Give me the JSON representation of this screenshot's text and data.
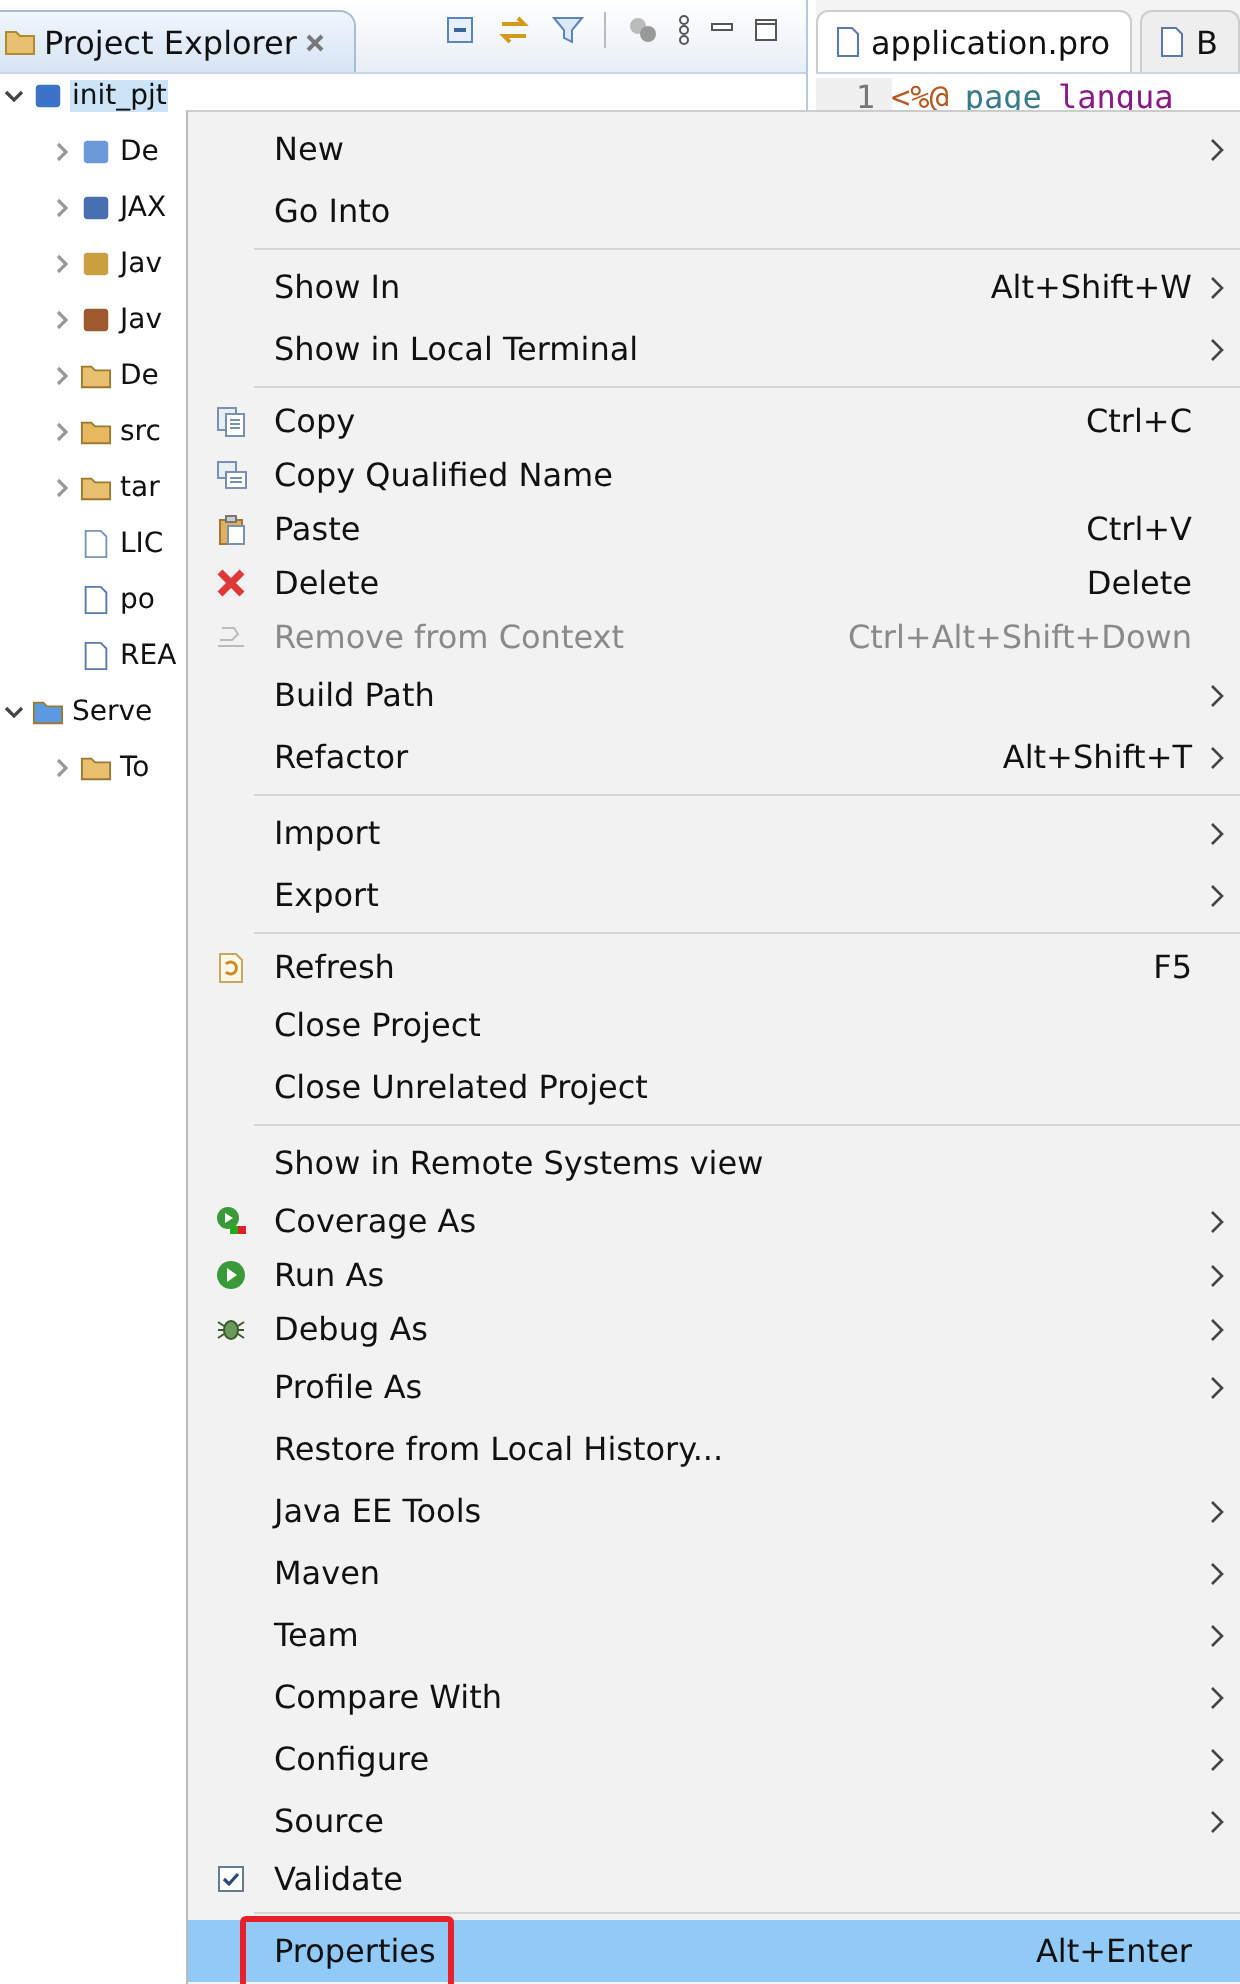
{
  "explorer": {
    "title": "Project Explorer",
    "tree": [
      {
        "label": "init_pjt",
        "kind": "node",
        "expanded": true,
        "selected": true,
        "children": [
          {
            "label": "De",
            "kind": "node",
            "expanded": false,
            "selected": false
          },
          {
            "label": "JAX",
            "kind": "node",
            "expanded": false,
            "selected": false
          },
          {
            "label": "Jav",
            "kind": "node",
            "expanded": false,
            "selected": false
          },
          {
            "label": "Jav",
            "kind": "node",
            "expanded": false,
            "selected": false
          },
          {
            "label": "De",
            "kind": "node",
            "expanded": false,
            "selected": false
          },
          {
            "label": "src",
            "kind": "node",
            "expanded": false,
            "selected": false
          },
          {
            "label": "tar",
            "kind": "node",
            "expanded": false,
            "selected": false
          },
          {
            "label": "LIC",
            "kind": "leaf",
            "selected": false
          },
          {
            "label": "po",
            "kind": "leaf",
            "selected": false
          },
          {
            "label": "REA",
            "kind": "leaf",
            "selected": false
          }
        ]
      },
      {
        "label": "Serve",
        "kind": "node",
        "expanded": true,
        "selected": false,
        "children": [
          {
            "label": "To",
            "kind": "node",
            "expanded": false,
            "selected": false
          }
        ]
      }
    ]
  },
  "editor": {
    "tabs": [
      {
        "label": "application.pro",
        "selected": true
      },
      {
        "label": "B",
        "selected": false
      }
    ],
    "lines": [
      {
        "number": "1",
        "tokens": [
          {
            "text": "<%@",
            "kind": "tag"
          },
          {
            "text": "page",
            "kind": "keyword"
          },
          {
            "text": "langua",
            "kind": "attr"
          }
        ]
      }
    ]
  },
  "menu": [
    {
      "kind": "item",
      "label": "New",
      "submenu": true,
      "disabled": false,
      "selected": false,
      "outlined": false
    },
    {
      "kind": "item",
      "label": "Go Into",
      "submenu": false,
      "disabled": false,
      "selected": false,
      "outlined": false
    },
    {
      "kind": "separator"
    },
    {
      "kind": "item",
      "label": "Show In",
      "shortcut": "Alt+Shift+W",
      "submenu": true,
      "disabled": false,
      "selected": false,
      "outlined": false
    },
    {
      "kind": "item",
      "label": "Show in Local Terminal",
      "submenu": true,
      "disabled": false,
      "selected": false,
      "outlined": false
    },
    {
      "kind": "separator"
    },
    {
      "kind": "item",
      "label": "Copy",
      "shortcut": "Ctrl+C",
      "submenu": false,
      "disabled": false,
      "selected": false,
      "outlined": false
    },
    {
      "kind": "item",
      "label": "Copy Qualified Name",
      "submenu": false,
      "disabled": false,
      "selected": false,
      "outlined": false
    },
    {
      "kind": "item",
      "label": "Paste",
      "shortcut": "Ctrl+V",
      "submenu": false,
      "disabled": false,
      "selected": false,
      "outlined": false
    },
    {
      "kind": "item",
      "label": "Delete",
      "shortcut": "Delete",
      "submenu": false,
      "disabled": false,
      "selected": false,
      "outlined": false
    },
    {
      "kind": "item",
      "label": "Remove from Context",
      "shortcut": "Ctrl+Alt+Shift+Down",
      "submenu": false,
      "disabled": true,
      "selected": false,
      "outlined": false
    },
    {
      "kind": "item",
      "label": "Build Path",
      "submenu": true,
      "disabled": false,
      "selected": false,
      "outlined": false
    },
    {
      "kind": "item",
      "label": "Refactor",
      "shortcut": "Alt+Shift+T",
      "submenu": true,
      "disabled": false,
      "selected": false,
      "outlined": false
    },
    {
      "kind": "separator"
    },
    {
      "kind": "item",
      "label": "Import",
      "submenu": true,
      "disabled": false,
      "selected": false,
      "outlined": false
    },
    {
      "kind": "item",
      "label": "Export",
      "submenu": true,
      "disabled": false,
      "selected": false,
      "outlined": false
    },
    {
      "kind": "separator"
    },
    {
      "kind": "item",
      "label": "Refresh",
      "shortcut": "F5",
      "submenu": false,
      "disabled": false,
      "selected": false,
      "outlined": false
    },
    {
      "kind": "item",
      "label": "Close Project",
      "submenu": false,
      "disabled": false,
      "selected": false,
      "outlined": false
    },
    {
      "kind": "item",
      "label": "Close Unrelated Project",
      "submenu": false,
      "disabled": false,
      "selected": false,
      "outlined": false
    },
    {
      "kind": "separator"
    },
    {
      "kind": "item",
      "label": "Show in Remote Systems view",
      "submenu": false,
      "disabled": false,
      "selected": false,
      "outlined": false
    },
    {
      "kind": "item",
      "label": "Coverage As",
      "submenu": true,
      "disabled": false,
      "selected": false,
      "outlined": false
    },
    {
      "kind": "item",
      "label": "Run As",
      "submenu": true,
      "disabled": false,
      "selected": false,
      "outlined": false
    },
    {
      "kind": "item",
      "label": "Debug As",
      "submenu": true,
      "disabled": false,
      "selected": false,
      "outlined": false
    },
    {
      "kind": "item",
      "label": "Profile As",
      "submenu": true,
      "disabled": false,
      "selected": false,
      "outlined": false
    },
    {
      "kind": "item",
      "label": "Restore from Local History...",
      "submenu": false,
      "disabled": false,
      "selected": false,
      "outlined": false
    },
    {
      "kind": "item",
      "label": "Java EE Tools",
      "submenu": true,
      "disabled": false,
      "selected": false,
      "outlined": false
    },
    {
      "kind": "item",
      "label": "Maven",
      "submenu": true,
      "disabled": false,
      "selected": false,
      "outlined": false
    },
    {
      "kind": "item",
      "label": "Team",
      "submenu": true,
      "disabled": false,
      "selected": false,
      "outlined": false
    },
    {
      "kind": "item",
      "label": "Compare With",
      "submenu": true,
      "disabled": false,
      "selected": false,
      "outlined": false
    },
    {
      "kind": "item",
      "label": "Configure",
      "submenu": true,
      "disabled": false,
      "selected": false,
      "outlined": false
    },
    {
      "kind": "item",
      "label": "Source",
      "submenu": true,
      "disabled": false,
      "selected": false,
      "outlined": false
    },
    {
      "kind": "check",
      "label": "Validate",
      "checked": true,
      "submenu": false,
      "disabled": false,
      "selected": false,
      "outlined": false
    },
    {
      "kind": "separator"
    },
    {
      "kind": "item",
      "label": "Properties",
      "shortcut": "Alt+Enter",
      "submenu": false,
      "disabled": false,
      "selected": true,
      "outlined": true
    }
  ]
}
